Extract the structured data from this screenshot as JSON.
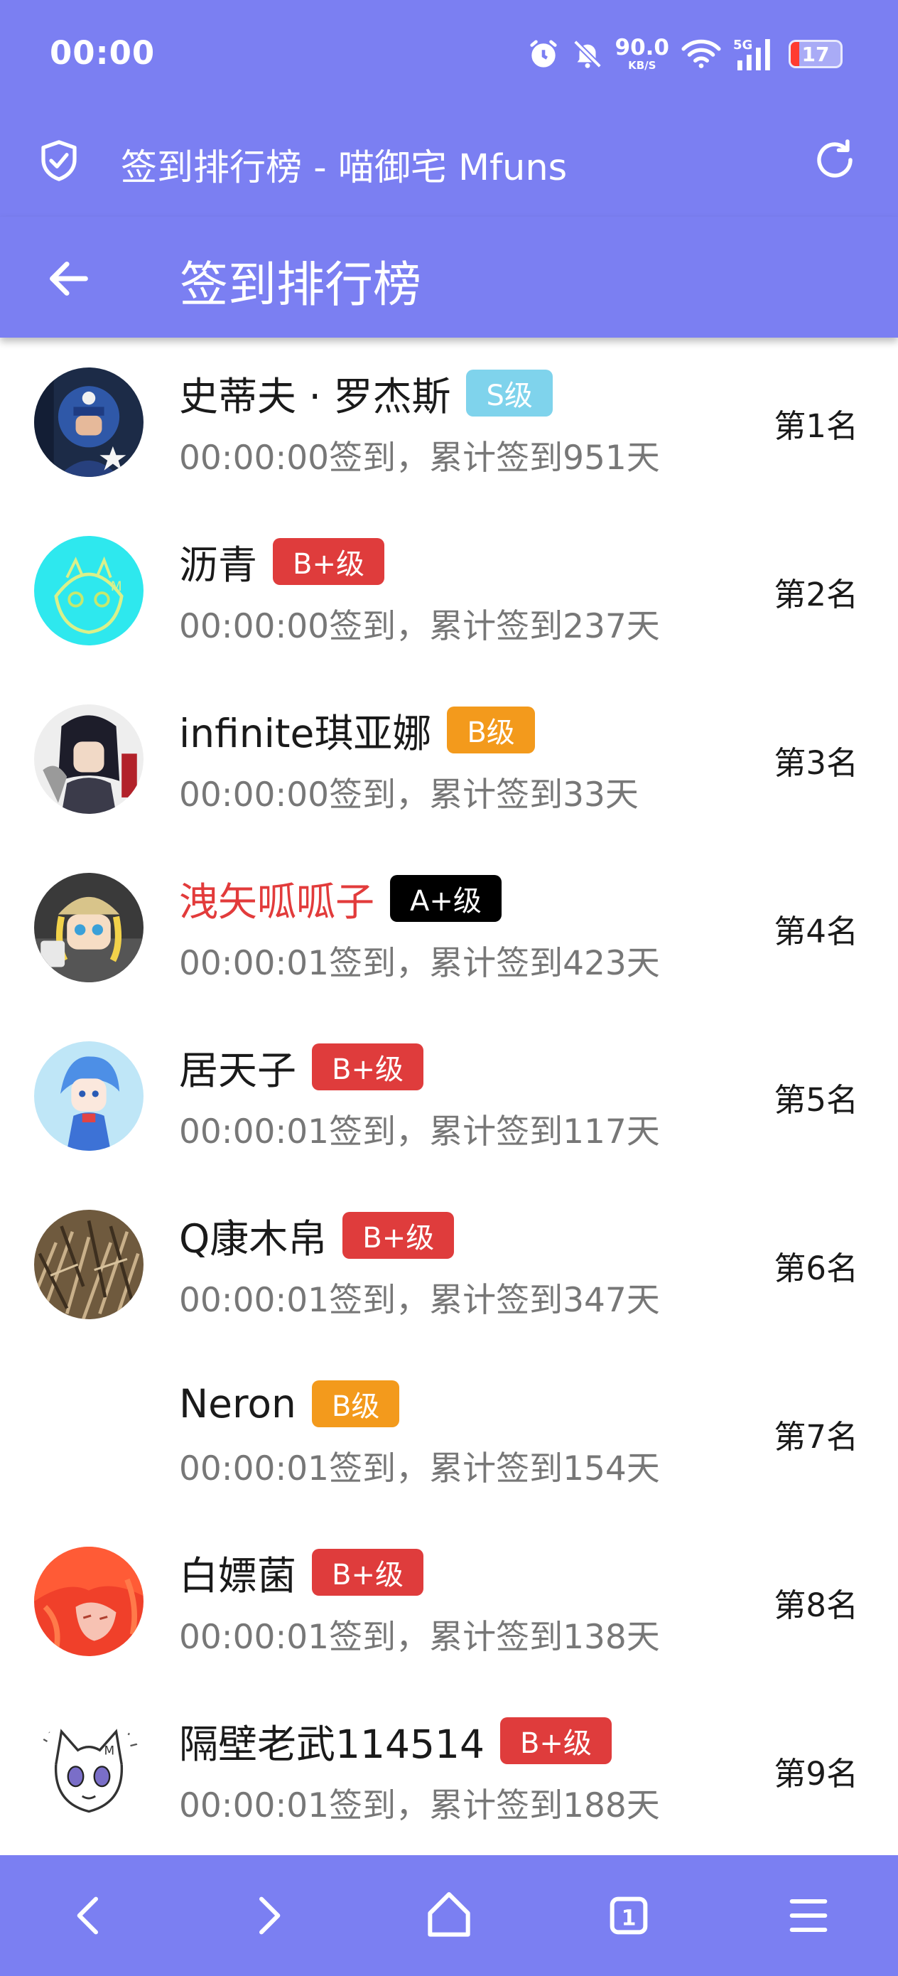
{
  "status_bar": {
    "time": "00:00",
    "net_speed_value": "90.0",
    "net_speed_unit": "KB/S",
    "signal_label": "5G",
    "battery_level": "17",
    "battery_fraction": 0.17,
    "icons": [
      "alarm-icon",
      "mute-bell-icon",
      "wifi-icon",
      "signal-icon",
      "battery-icon"
    ]
  },
  "browser": {
    "page_title": "签到排行榜 - 喵御宅 Mfuns",
    "icons": [
      "shield-check-icon",
      "reload-icon"
    ]
  },
  "header": {
    "title": "签到排行榜",
    "back_icon": "arrow-left-icon"
  },
  "colors": {
    "primary": "#7b7ff2",
    "badge_S": "#7fd3ec",
    "badge_Bplus": "#df3c3c",
    "badge_B": "#f39a1c",
    "badge_Aplus": "#000000",
    "highlight_name": "#e23b3b"
  },
  "leaderboard": [
    {
      "name": "史蒂夫 · 罗杰斯",
      "badge": "S级",
      "badge_color": "#7fd3ec",
      "checkin": "00:00:00签到，累计签到951天",
      "rank": "第1名",
      "avatar": "captain-america-avatar"
    },
    {
      "name": "沥青",
      "badge": "B+级",
      "badge_color": "#df3c3c",
      "checkin": "00:00:00签到，累计签到237天",
      "rank": "第2名",
      "avatar": "cyan-anime-avatar"
    },
    {
      "name": "infinite琪亚娜",
      "badge": "B级",
      "badge_color": "#f39a1c",
      "checkin": "00:00:00签到，累计签到33天",
      "rank": "第3名",
      "avatar": "dark-hair-anime-avatar"
    },
    {
      "name": "洩矢呱呱子",
      "badge": "A+级",
      "badge_color": "#000000",
      "checkin": "00:00:01签到，累计签到423天",
      "rank": "第4名",
      "avatar": "figure-doll-avatar",
      "name_color": "#e23b3b"
    },
    {
      "name": "居天子",
      "badge": "B+级",
      "badge_color": "#df3c3c",
      "checkin": "00:00:01签到，累计签到117天",
      "rank": "第5名",
      "avatar": "blue-fairy-avatar"
    },
    {
      "name": "Q康木帛",
      "badge": "B+级",
      "badge_color": "#df3c3c",
      "checkin": "00:00:01签到，累计签到347天",
      "rank": "第6名",
      "avatar": "dry-grass-avatar"
    },
    {
      "name": "Neron",
      "badge": "B级",
      "badge_color": "#f39a1c",
      "checkin": "00:00:01签到，累计签到154天",
      "rank": "第7名",
      "avatar": "blank-avatar"
    },
    {
      "name": "白嫖菌",
      "badge": "B+级",
      "badge_color": "#df3c3c",
      "checkin": "00:00:01签到，累计签到138天",
      "rank": "第8名",
      "avatar": "red-hair-avatar"
    },
    {
      "name": "隔壁老武114514",
      "badge": "B+级",
      "badge_color": "#df3c3c",
      "checkin": "00:00:01签到，累计签到188天",
      "rank": "第9名",
      "avatar": "sketch-cat-girl-avatar"
    }
  ],
  "bottom_nav": {
    "tab_count": "1",
    "icons": [
      "back-chevron-icon",
      "forward-chevron-icon",
      "home-icon",
      "tabs-icon",
      "menu-icon"
    ]
  }
}
